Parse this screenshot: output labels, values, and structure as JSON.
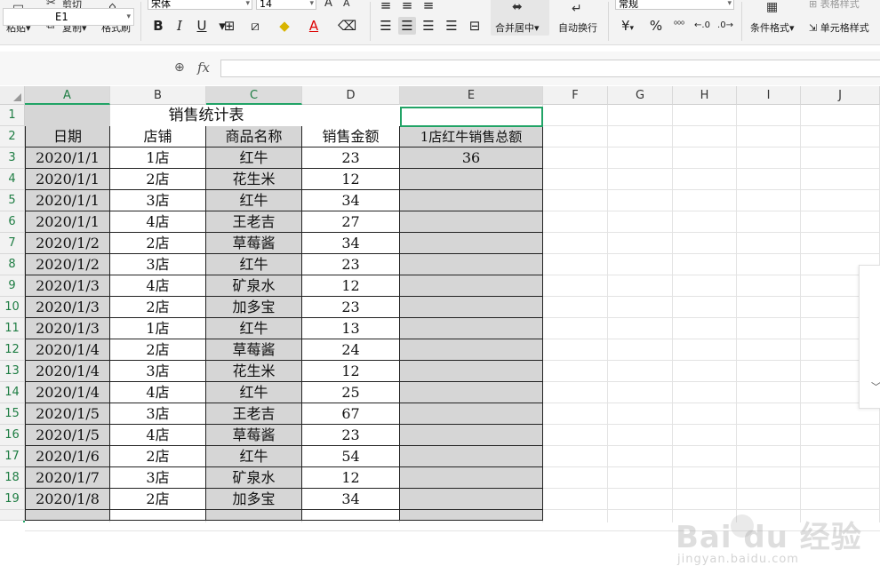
{
  "ribbon": {
    "cut": "剪切",
    "paste": "粘贴",
    "copy": "复制",
    "format_painter": "格式刷",
    "font_name": "宋体",
    "font_size": "14",
    "merge_center": "合并居中",
    "wrap_text": "自动换行",
    "number_format": "常规",
    "cond_format": "条件格式",
    "cell_style": "单元格样式",
    "table_style": "表格样式",
    "currency": "¥",
    "percent": "%",
    "bold": "B",
    "italic": "I",
    "underline": "U",
    "font_color_letter": "A",
    "inc_font": "A",
    "dec_font": "A"
  },
  "formula_bar": {
    "name_box": "E1",
    "fx": "fx",
    "formula": ""
  },
  "columns": [
    "A",
    "B",
    "C",
    "D",
    "E",
    "F",
    "G",
    "H",
    "I",
    "J"
  ],
  "rows": [
    "1",
    "2",
    "3",
    "4",
    "5",
    "6",
    "7",
    "8",
    "9",
    "10",
    "11",
    "12",
    "13",
    "14",
    "15",
    "16",
    "17",
    "18",
    "19"
  ],
  "title": "销售统计表",
  "headers": [
    "日期",
    "店铺",
    "商品名称",
    "销售金额",
    "1店红牛销售总额"
  ],
  "e3_value": "36",
  "data": [
    [
      "2020/1/1",
      "1店",
      "红牛",
      "23"
    ],
    [
      "2020/1/1",
      "2店",
      "花生米",
      "12"
    ],
    [
      "2020/1/1",
      "3店",
      "红牛",
      "34"
    ],
    [
      "2020/1/1",
      "4店",
      "王老吉",
      "27"
    ],
    [
      "2020/1/2",
      "2店",
      "草莓酱",
      "34"
    ],
    [
      "2020/1/2",
      "3店",
      "红牛",
      "23"
    ],
    [
      "2020/1/3",
      "4店",
      "矿泉水",
      "12"
    ],
    [
      "2020/1/3",
      "2店",
      "加多宝",
      "23"
    ],
    [
      "2020/1/3",
      "1店",
      "红牛",
      "13"
    ],
    [
      "2020/1/4",
      "2店",
      "草莓酱",
      "24"
    ],
    [
      "2020/1/4",
      "3店",
      "花生米",
      "12"
    ],
    [
      "2020/1/4",
      "4店",
      "红牛",
      "25"
    ],
    [
      "2020/1/5",
      "3店",
      "王老吉",
      "67"
    ],
    [
      "2020/1/5",
      "4店",
      "草莓酱",
      "23"
    ],
    [
      "2020/1/6",
      "2店",
      "红牛",
      "54"
    ],
    [
      "2020/1/7",
      "3店",
      "矿泉水",
      "12"
    ],
    [
      "2020/1/8",
      "2店",
      "加多宝",
      "34"
    ]
  ],
  "watermark": {
    "brand": "Bai du 经验",
    "url": "jingyan.baidu.com"
  },
  "colors": {
    "accent": "#21a366",
    "fill_gray": "#d6d6d6"
  }
}
